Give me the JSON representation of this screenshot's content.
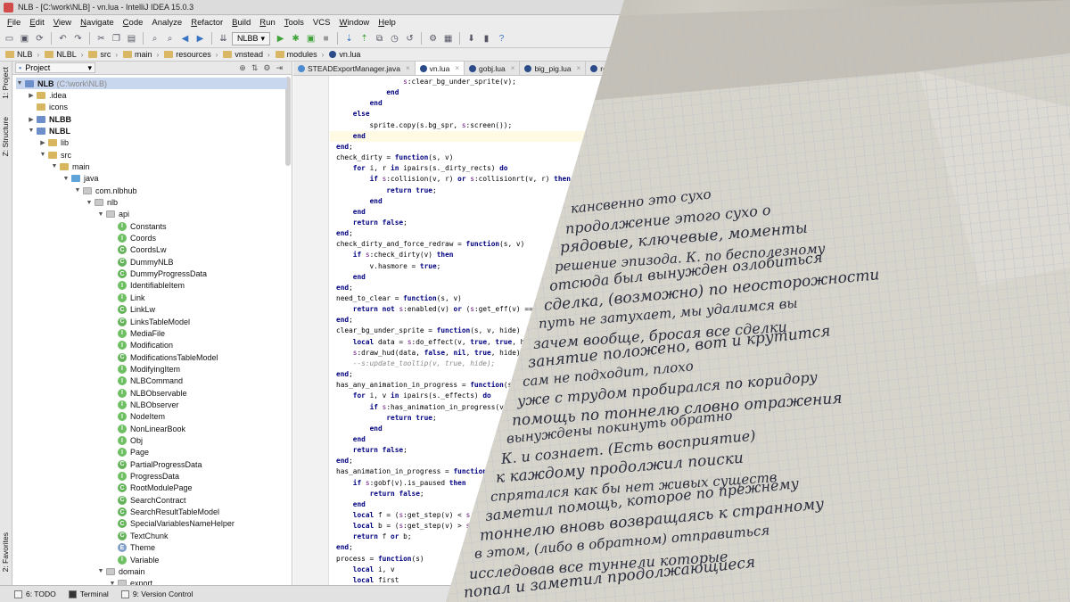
{
  "window": {
    "title": "NLB - [C:\\work\\NLB] - vn.lua - IntelliJ IDEA 15.0.3"
  },
  "menu": [
    {
      "u": "F",
      "rest": "ile"
    },
    {
      "u": "E",
      "rest": "dit"
    },
    {
      "u": "V",
      "rest": "iew"
    },
    {
      "u": "N",
      "rest": "avigate"
    },
    {
      "u": "C",
      "rest": "ode"
    },
    {
      "u": "",
      "rest": "Analyze"
    },
    {
      "u": "R",
      "rest": "efactor"
    },
    {
      "u": "B",
      "rest": "uild"
    },
    {
      "u": "R",
      "rest": "un"
    },
    {
      "u": "T",
      "rest": "ools"
    },
    {
      "u": "",
      "rest": "VCS"
    },
    {
      "u": "W",
      "rest": "indow"
    },
    {
      "u": "H",
      "rest": "elp"
    }
  ],
  "toolbar": {
    "run_config": "NLBB"
  },
  "breadcrumbs": [
    "NLB",
    "NLBL",
    "src",
    "main",
    "resources",
    "vnstead",
    "modules",
    "vn.lua"
  ],
  "project_panel": {
    "view_label": "Project",
    "side_tabs": {
      "project": "1: Project",
      "structure": "Z: Structure",
      "favorites": "2: Favorites"
    },
    "tree": [
      {
        "label": "NLB",
        "note": "(C:\\work\\NLB)",
        "depth": 0,
        "kind": "module",
        "open": true,
        "selected": true
      },
      {
        "label": ".idea",
        "depth": 1,
        "kind": "folder",
        "open": false
      },
      {
        "label": "icons",
        "depth": 1,
        "kind": "folder",
        "open": null
      },
      {
        "label": "NLBB",
        "depth": 1,
        "kind": "module",
        "open": false,
        "bold": true
      },
      {
        "label": "NLBL",
        "depth": 1,
        "kind": "module",
        "open": true,
        "bold": true
      },
      {
        "label": "lib",
        "depth": 2,
        "kind": "folder",
        "open": false
      },
      {
        "label": "src",
        "depth": 2,
        "kind": "folder",
        "open": true
      },
      {
        "label": "main",
        "depth": 3,
        "kind": "folder",
        "open": true
      },
      {
        "label": "java",
        "depth": 4,
        "kind": "src",
        "open": true
      },
      {
        "label": "com.nlbhub",
        "depth": 5,
        "kind": "pkg",
        "open": true
      },
      {
        "label": "nlb",
        "depth": 6,
        "kind": "pkg",
        "open": true
      },
      {
        "label": "api",
        "depth": 7,
        "kind": "pkg",
        "open": true
      },
      {
        "label": "Constants",
        "depth": 8,
        "kind": "iface"
      },
      {
        "label": "Coords",
        "depth": 8,
        "kind": "iface"
      },
      {
        "label": "CoordsLw",
        "depth": 8,
        "kind": "class"
      },
      {
        "label": "DummyNLB",
        "depth": 8,
        "kind": "class"
      },
      {
        "label": "DummyProgressData",
        "depth": 8,
        "kind": "class"
      },
      {
        "label": "IdentifiableItem",
        "depth": 8,
        "kind": "iface"
      },
      {
        "label": "Link",
        "depth": 8,
        "kind": "iface"
      },
      {
        "label": "LinkLw",
        "depth": 8,
        "kind": "class"
      },
      {
        "label": "LinksTableModel",
        "depth": 8,
        "kind": "class"
      },
      {
        "label": "MediaFile",
        "depth": 8,
        "kind": "iface"
      },
      {
        "label": "Modification",
        "depth": 8,
        "kind": "iface"
      },
      {
        "label": "ModificationsTableModel",
        "depth": 8,
        "kind": "class"
      },
      {
        "label": "ModifyingItem",
        "depth": 8,
        "kind": "iface"
      },
      {
        "label": "NLBCommand",
        "depth": 8,
        "kind": "iface"
      },
      {
        "label": "NLBObservable",
        "depth": 8,
        "kind": "iface"
      },
      {
        "label": "NLBObserver",
        "depth": 8,
        "kind": "iface"
      },
      {
        "label": "NodeItem",
        "depth": 8,
        "kind": "iface"
      },
      {
        "label": "NonLinearBook",
        "depth": 8,
        "kind": "iface"
      },
      {
        "label": "Obj",
        "depth": 8,
        "kind": "iface"
      },
      {
        "label": "Page",
        "depth": 8,
        "kind": "iface"
      },
      {
        "label": "PartialProgressData",
        "depth": 8,
        "kind": "class"
      },
      {
        "label": "ProgressData",
        "depth": 8,
        "kind": "iface"
      },
      {
        "label": "RootModulePage",
        "depth": 8,
        "kind": "class"
      },
      {
        "label": "SearchContract",
        "depth": 8,
        "kind": "class"
      },
      {
        "label": "SearchResultTableModel",
        "depth": 8,
        "kind": "class"
      },
      {
        "label": "SpecialVariablesNameHelper",
        "depth": 8,
        "kind": "class"
      },
      {
        "label": "TextChunk",
        "depth": 8,
        "kind": "class"
      },
      {
        "label": "Theme",
        "depth": 8,
        "kind": "enum"
      },
      {
        "label": "Variable",
        "depth": 8,
        "kind": "iface"
      },
      {
        "label": "domain",
        "depth": 7,
        "kind": "pkg",
        "open": true
      },
      {
        "label": "export",
        "depth": 8,
        "kind": "pkg",
        "open": true
      }
    ]
  },
  "editor": {
    "tabs": [
      {
        "label": "STEADExportManager.java",
        "kind": "java",
        "active": false
      },
      {
        "label": "vn.lua",
        "kind": "lua",
        "active": true
      },
      {
        "label": "gobj.lua",
        "kind": "lua",
        "active": false
      },
      {
        "label": "big_pig.lua",
        "kind": "lua",
        "active": false
      },
      {
        "label": "rew",
        "kind": "lua",
        "active": false
      }
    ],
    "current_line": 5,
    "lines": [
      "                s:clear_bg_under_sprite(v);",
      "            end",
      "        end",
      "    else",
      "        sprite.copy(s.bg_spr, s:screen());",
      "    end",
      "end;",
      "check_dirty = function(s, v)",
      "    for i, r in ipairs(s._dirty_rects) do",
      "        if s:collision(v, r) or s:collisionrt(v, r) then",
      "            return true;",
      "        end",
      "    end",
      "    return false;",
      "end;",
      "check_dirty_and_force_redraw = function(s, v)",
      "    if s:check_dirty(v) then",
      "        v.hasmore = true;",
      "    end",
      "end;",
      "need_to_clear = function(s, v)",
      "    return not s:enabled(v) or (s:get_eff(v) ==",
      "end;",
      "clear_bg_under_sprite = function(s, v, hide)",
      "    local data = s:do_effect(v, true, true, hide",
      "    s:draw_hud(data, false, nil, true, hide);",
      "    --s:update_tooltip(v, true, hide);",
      "end;",
      "has_any_animation_in_progress = function(s)",
      "    for i, v in ipairs(s._effects) do",
      "        if s:has_animation_in_progress(v)",
      "            return true;",
      "        end",
      "    end",
      "    return false;",
      "end;",
      "has_animation_in_progress = function",
      "    if s:gobf(v).is_paused then",
      "        return false;",
      "    end",
      "    local f = (s:get_step(v) < s:",
      "    local b = (s:get_step(v) > s:",
      "    return f or b;",
      "end;",
      "process = function(s)",
      "    local i, v",
      "    local first",
      "    local cbresult = false;",
      "    if s:has_any_animation_i",
      "        s:enter_direct();"
    ]
  },
  "status_bar": {
    "todo": "6: TODO",
    "terminal": "Terminal",
    "vcs": "9: Version Control"
  },
  "photo": {
    "handwriting": [
      "кансвенно это сухо",
      "продолжение этого сухо о",
      "рядовые, ключевые, моменты",
      "решение эпизода. К. по бесполезному",
      "отсюда был вынужден озлобиться",
      "сделка, (возможно) по неосторожности",
      "путь не затухает, мы удалимся вы",
      "зачем вообще, бросая все сделки",
      "занятие положено, вот и крутится",
      "сам не подходит, плохо",
      "уже с трудом пробирался по коридору",
      "помощь по тоннелю словно отражения",
      "вынуждены покинуть обратно",
      "К. и сознает. (Есть восприятие)",
      "к каждому продолжил поиски",
      "спрятался как бы нет живых существ",
      "заметил помощь, которое по прежнему",
      "тоннелю вновь возвращаясь к странному",
      "в этом, (либо в обратном) отправиться",
      "исследовав все туннели которые",
      "попал и заметил продолжающиеся"
    ]
  }
}
